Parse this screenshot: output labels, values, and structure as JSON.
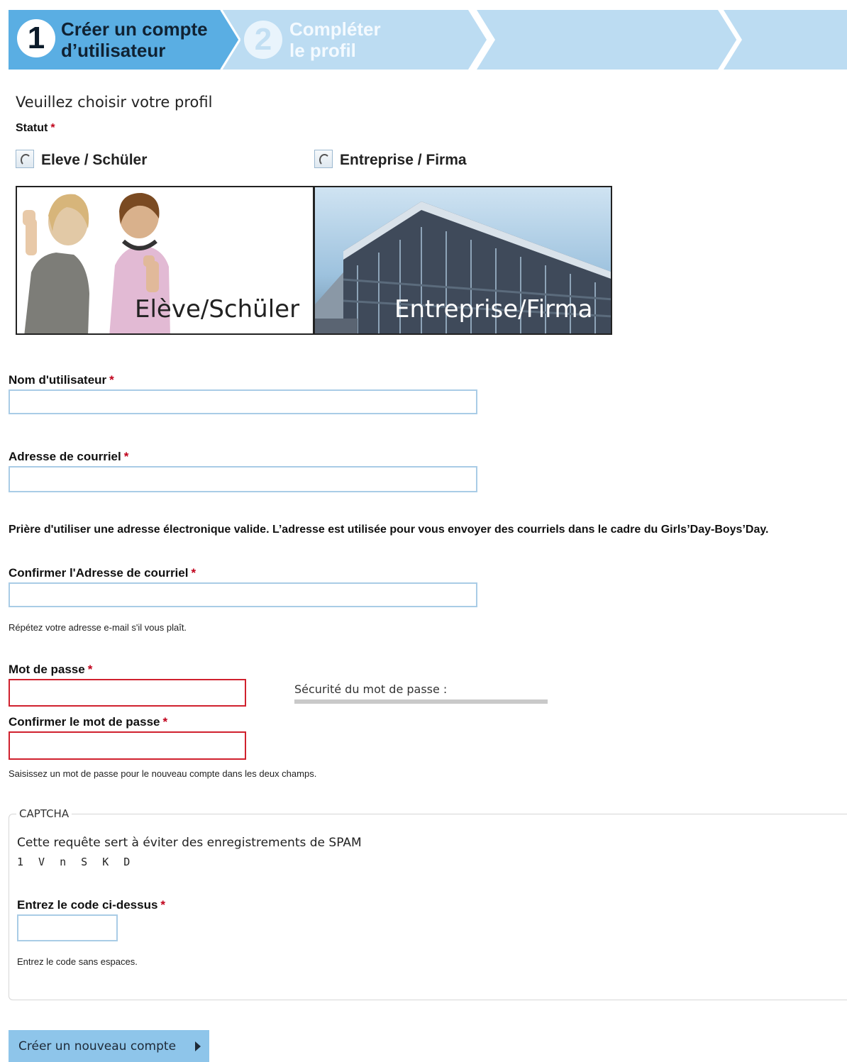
{
  "steps": [
    {
      "number": "1",
      "line1": "Créer un compte",
      "line2": "d’utilisateur",
      "active": true
    },
    {
      "number": "2",
      "line1": "Compléter",
      "line2": "le profil",
      "active": false
    }
  ],
  "colors": {
    "step_active": "#5aaee3",
    "step_inactive": "#bcdcf2",
    "required": "#c0001a",
    "field_border": "#a9cce6",
    "field_error_border": "#d0212e",
    "button": "#8ec5ea"
  },
  "profile": {
    "heading": "Veuillez choisir votre profil",
    "status_label": "Statut",
    "required_mark": "*",
    "options": [
      {
        "label": "Eleve / Schüler",
        "caption": "Elève/Schüler"
      },
      {
        "label": "Entreprise / Firma",
        "caption": "Entreprise/Firma"
      }
    ]
  },
  "form": {
    "username_label": "Nom d'utilisateur",
    "email_label": "Adresse de courriel",
    "email_note": "Prière d'utiliser une adresse électronique valide. L’adresse est utilisée pour vous envoyer des courriels dans le cadre du Girls’Day-Boys’Day.",
    "confirm_email_label": "Confirmer l'Adresse de courriel",
    "confirm_email_help": "Répétez votre adresse e-mail s'il vous plaît.",
    "password_label": "Mot de passe",
    "password_strength_label": "Sécurité du mot de passe :",
    "confirm_password_label": "Confirmer le mot de passe",
    "password_help": "Saisissez un mot de passe pour le nouveau compte dans les deux champs."
  },
  "captcha": {
    "legend": "CAPTCHA",
    "description": "Cette requête sert à éviter des enregistrements de SPAM",
    "code": "1 V n S K D",
    "input_label": "Entrez le code ci-dessus",
    "help": "Entrez le code sans espaces."
  },
  "submit_label": "Créer un nouveau compte"
}
